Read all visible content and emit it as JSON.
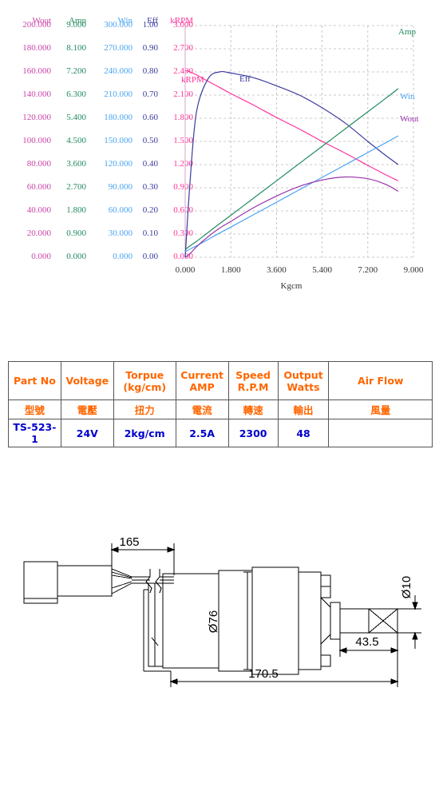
{
  "chart": {
    "x_axis": {
      "title": "Kgcm",
      "ticks": [
        "0.000",
        "1.800",
        "3.600",
        "5.400",
        "7.200",
        "9.000"
      ],
      "min": 0,
      "max": 9
    },
    "y_columns": [
      {
        "name": "Wout",
        "header": "Wout",
        "color": "#cc44aa",
        "ticks": [
          "200.000",
          "180.000",
          "160.000",
          "140.000",
          "120.000",
          "100.000",
          "80.000",
          "60.000",
          "40.000",
          "20.000",
          "0.000"
        ],
        "min": 0,
        "max": 200
      },
      {
        "name": "Amp",
        "header": "Amp",
        "color": "#228b5e",
        "ticks": [
          "9.000",
          "8.100",
          "7.200",
          "6.300",
          "5.400",
          "4.500",
          "3.600",
          "2.700",
          "1.800",
          "0.900",
          "0.000"
        ],
        "min": 0,
        "max": 9
      },
      {
        "name": "Win",
        "header": "Win",
        "color": "#4aa3f0",
        "ticks": [
          "300.000",
          "270.000",
          "240.000",
          "210.000",
          "180.000",
          "150.000",
          "120.000",
          "90.000",
          "60.000",
          "30.000",
          "0.000"
        ],
        "min": 0,
        "max": 300
      },
      {
        "name": "Eff",
        "header": "Eff",
        "color": "#3b3b9e",
        "ticks": [
          "1.00",
          "0.90",
          "0.80",
          "0.70",
          "0.60",
          "0.50",
          "0.40",
          "0.30",
          "0.20",
          "0.10",
          "0.00"
        ],
        "min": 0,
        "max": 1
      },
      {
        "name": "kRPM",
        "header": "kRPM",
        "color": "#ff3399",
        "ticks": [
          "3.000",
          "2.700",
          "2.400",
          "2.100",
          "1.800",
          "1.500",
          "1.200",
          "0.900",
          "0.600",
          "0.300",
          "0.000"
        ],
        "min": 0,
        "max": 3
      }
    ],
    "curve_labels": [
      {
        "text": "Amp",
        "color": "#228b5e"
      },
      {
        "text": "Win",
        "color": "#4aa3f0"
      },
      {
        "text": "Wout",
        "color": "#9933aa"
      },
      {
        "text": "Eff",
        "color": "#3b3b9e"
      },
      {
        "text": "kRPM",
        "color": "#ff3399"
      }
    ]
  },
  "chart_data": {
    "type": "line",
    "title": "",
    "xlabel": "Kgcm",
    "ylabel": "",
    "xlim": [
      0,
      9
    ],
    "grid": true,
    "legend": "inline-end-of-curve",
    "x": [
      0,
      0.2,
      0.45,
      0.9,
      1.35,
      1.8,
      2.7,
      3.6,
      4.5,
      5.4,
      6.3,
      7.2,
      7.9,
      8.4
    ],
    "series": [
      {
        "name": "kRPM",
        "color": "#ff3399",
        "ylim": [
          0,
          3
        ],
        "unit": "kRPM",
        "values": [
          2.42,
          2.4,
          2.36,
          2.28,
          2.2,
          2.12,
          1.97,
          1.81,
          1.66,
          1.5,
          1.35,
          1.19,
          1.07,
          0.99
        ]
      },
      {
        "name": "Eff",
        "color": "#3b3b9e",
        "ylim": [
          0,
          1
        ],
        "unit": "",
        "values": [
          0.0,
          0.34,
          0.63,
          0.77,
          0.8,
          0.795,
          0.775,
          0.74,
          0.7,
          0.645,
          0.58,
          0.5,
          0.44,
          0.4
        ]
      },
      {
        "name": "Amp",
        "color": "#228b5e",
        "ylim": [
          0,
          9
        ],
        "unit": "AMP",
        "values": [
          0.3,
          0.45,
          0.62,
          0.96,
          1.3,
          1.63,
          2.3,
          2.97,
          3.64,
          4.31,
          4.98,
          5.65,
          6.17,
          6.55
        ]
      },
      {
        "name": "Win",
        "color": "#4aa3f0",
        "ylim": [
          0,
          300
        ],
        "unit": "Watts",
        "values": [
          7.2,
          10.8,
          14.9,
          23.0,
          31.2,
          39.1,
          55.2,
          71.3,
          87.4,
          103.4,
          119.5,
          135.6,
          148.1,
          157.2
        ]
      },
      {
        "name": "Wout",
        "color": "#9933aa",
        "ylim": [
          0,
          200
        ],
        "unit": "Watts",
        "values": [
          0.0,
          3.4,
          9.1,
          17.7,
          25.0,
          31.0,
          42.8,
          52.8,
          61.2,
          66.7,
          69.3,
          67.8,
          63.0,
          57.0
        ]
      }
    ]
  },
  "spec_table": {
    "headers_en": [
      "Part No",
      "Voltage",
      "Torpue\n(kg/cm)",
      "Current\nAMP",
      "Speed\nR.P.M",
      "Output\nWatts",
      "Air  Flow"
    ],
    "headers_en_l1": [
      "Part No",
      "Voltage",
      "Torpue",
      "Current",
      "Speed",
      "Output",
      "Air  Flow"
    ],
    "headers_en_l2": [
      "",
      "",
      "(kg/cm)",
      "AMP",
      "R.P.M",
      "Watts",
      ""
    ],
    "headers_cn": [
      "型號",
      "電壓",
      "扭力",
      "電流",
      "轉速",
      "輸出",
      "風量"
    ],
    "values": [
      "TS-523-1",
      "24V",
      "2kg/cm",
      "2.5A",
      "2300",
      "48",
      ""
    ],
    "header_color": "#ff6600",
    "value_color": "#0000cc"
  },
  "drawing": {
    "dimensions": {
      "cable_length": "165",
      "body_diameter": "Ø76",
      "shaft_diameter": "Ø10",
      "shaft_length": "43.5",
      "overall_length": "170.5"
    }
  }
}
